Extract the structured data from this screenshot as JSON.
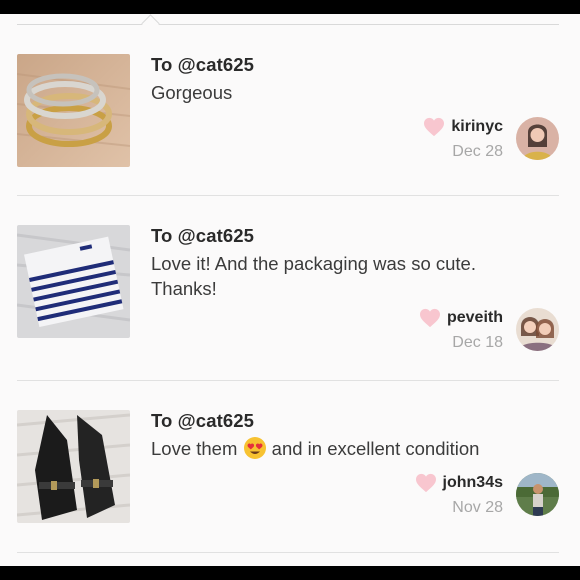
{
  "reviews": [
    {
      "to": "To @cat625",
      "message": "Gorgeous",
      "username": "kirinyc",
      "date": "Dec 28",
      "thumb_icon": "stacked-rings-photo",
      "avatar_icon": "user-avatar"
    },
    {
      "to": "To @cat625",
      "message": "Love it! And the packaging was so cute. Thanks!",
      "username": "peveith",
      "date": "Dec 18",
      "thumb_icon": "striped-sweater-photo",
      "avatar_icon": "user-avatar"
    },
    {
      "to": "To @cat625",
      "message_before": "Love them",
      "message_after": "and in excellent condition",
      "emoji": "heart-eyes-emoji",
      "username": "john34s",
      "date": "Nov 28",
      "thumb_icon": "black-heels-photo",
      "avatar_icon": "user-avatar"
    }
  ],
  "colors": {
    "heart": "#f8c6cf",
    "background": "#fbfafa",
    "divider": "#e1e1e1"
  }
}
